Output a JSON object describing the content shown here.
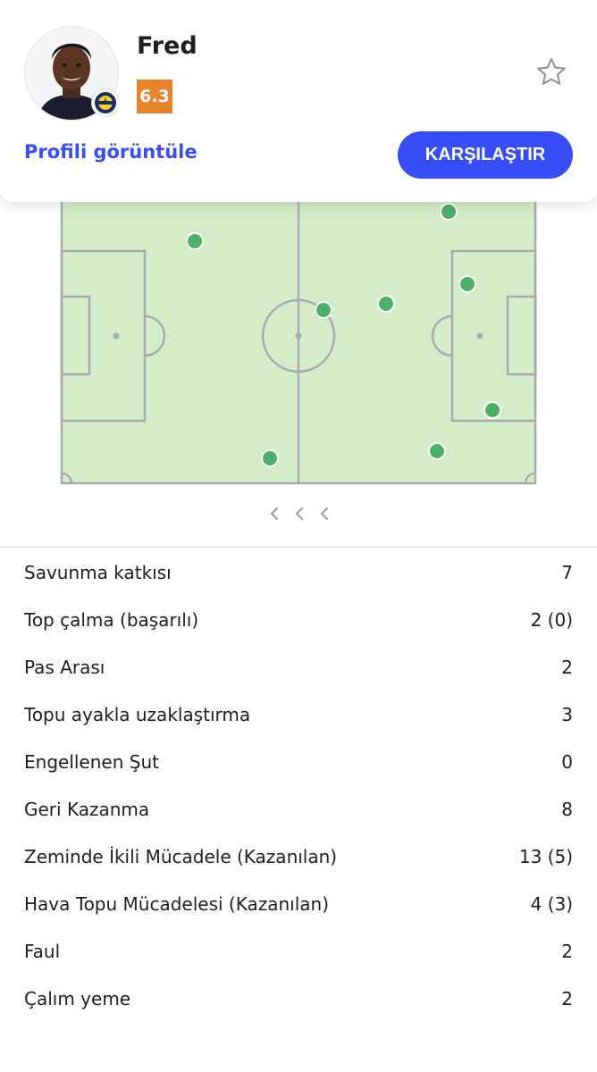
{
  "player": {
    "name": "Fred",
    "rating": "6.3",
    "rating_color": "#e8842b"
  },
  "actions": {
    "profile_link": "Profili görüntüle",
    "compare_button": "KARŞILAŞTIR",
    "accent_color": "#374df5"
  },
  "icons": {
    "favorite": "star-outline-icon",
    "club": "club-badge-icon",
    "pager": "chevron-left-icon"
  },
  "heatmap": {
    "dot_color": "#4caf6a",
    "pitch_color": "#d4edc8",
    "line_color": "#a9a9b2"
  },
  "stats": [
    {
      "label": "Savunma katkısı",
      "value": "7"
    },
    {
      "label": "Top çalma (başarılı)",
      "value": "2 (0)"
    },
    {
      "label": "Pas Arası",
      "value": "2"
    },
    {
      "label": "Topu ayakla uzaklaştırma",
      "value": "3"
    },
    {
      "label": "Engellenen Şut",
      "value": "0"
    },
    {
      "label": "Geri Kazanma",
      "value": "8"
    },
    {
      "label": "Zeminde İkili Mücadele (Kazanılan)",
      "value": "13 (5)"
    },
    {
      "label": "Hava Topu Mücadelesi (Kazanılan)",
      "value": "4 (3)"
    },
    {
      "label": "Faul",
      "value": "2"
    },
    {
      "label": "Çalım yeme",
      "value": "2"
    }
  ]
}
